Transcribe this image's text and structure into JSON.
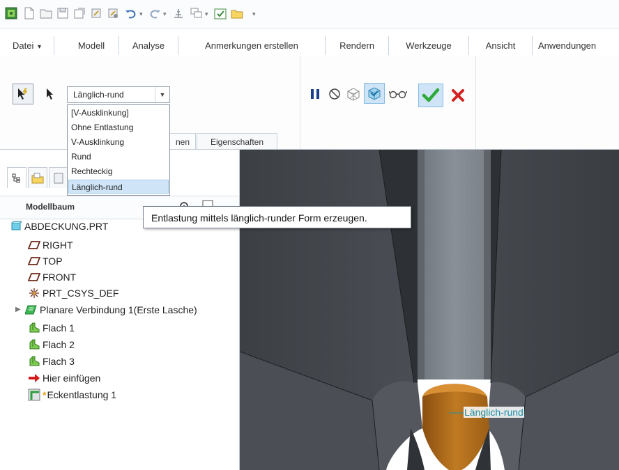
{
  "tabs": [
    {
      "label": "Datei",
      "dropdown": "▾"
    },
    {
      "label": "Modell"
    },
    {
      "label": "Analyse"
    },
    {
      "label": "Anmerkungen erstellen"
    },
    {
      "label": "Rendern"
    },
    {
      "label": "Werkzeuge"
    },
    {
      "label": "Ansicht"
    },
    {
      "label": "Anwendungen"
    }
  ],
  "relief_dropdown": {
    "selected": "Länglich-rund",
    "options": [
      "[V-Ausklinkung]",
      "Ohne Entlastung",
      "V-Ausklinkung",
      "Rund",
      "Rechteckig",
      "Länglich-rund"
    ]
  },
  "subtabs": {
    "hidden_fragment": "nen",
    "properties": "Eigenschaften"
  },
  "tooltip": "Entlastung mittels länglich-runder Form erzeugen.",
  "model_tree": {
    "title": "Modellbaum",
    "items": [
      {
        "label": "ABDECKUNG.PRT",
        "icon": "part-icon"
      },
      {
        "label": "RIGHT",
        "icon": "datum-plane-icon"
      },
      {
        "label": "TOP",
        "icon": "datum-plane-icon"
      },
      {
        "label": "FRONT",
        "icon": "datum-plane-icon"
      },
      {
        "label": "PRT_CSYS_DEF",
        "icon": "csys-icon"
      },
      {
        "label": "Planare Verbindung 1(Erste Lasche)",
        "icon": "planar-wall-icon"
      },
      {
        "label": "Flach 1",
        "icon": "flat-wall-icon"
      },
      {
        "label": "Flach 2",
        "icon": "flat-wall-icon"
      },
      {
        "label": "Flach 3",
        "icon": "flat-wall-icon"
      },
      {
        "label": "Hier einfügen",
        "icon": "insert-here-arrow-icon"
      },
      {
        "label": "Eckentlastung 1",
        "icon": "corner-relief-icon",
        "marker": "*"
      }
    ]
  },
  "viewport": {
    "dimension_label": "Länglich-rund"
  },
  "colors": {
    "accent": "#3a8fd6",
    "confirm": "#2eaa3a",
    "cancel": "#d42020",
    "relief_fill": "#b8731c",
    "dim_text": "#1a8fa8"
  }
}
